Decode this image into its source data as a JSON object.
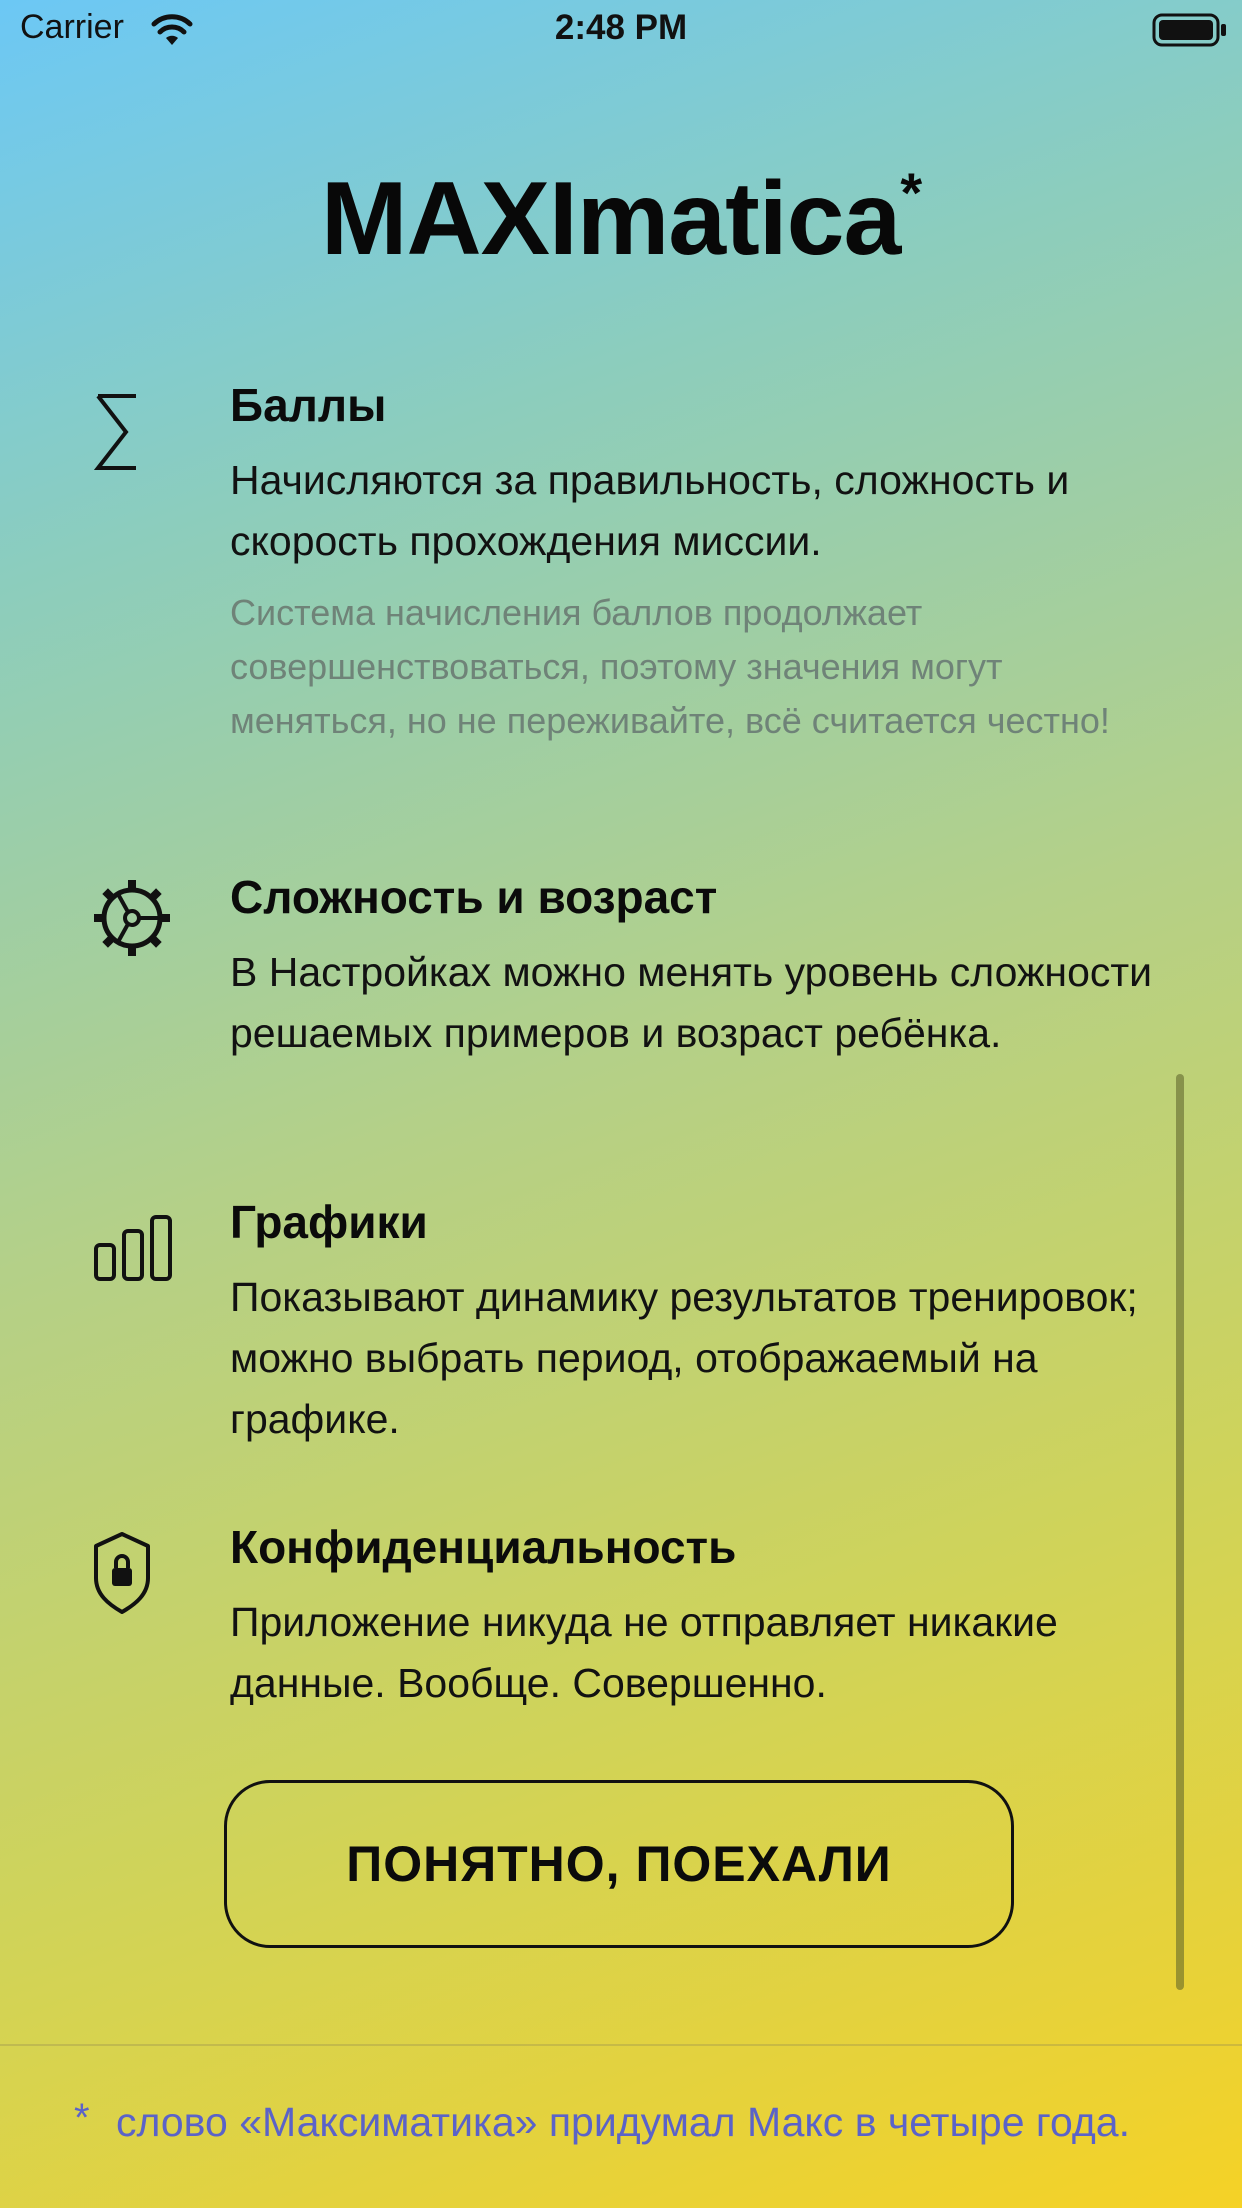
{
  "status_bar": {
    "carrier": "Carrier",
    "time": "2:48 PM",
    "wifi_icon": "wifi-icon",
    "battery_icon": "battery-icon"
  },
  "header": {
    "title": "MAXImatica",
    "asterisk": "*"
  },
  "features": [
    {
      "icon": "sigma-icon",
      "heading": "Баллы",
      "body": "Начисляются за правильность, сложность и скорость прохождения миссии.",
      "note": "Система начисления баллов продолжает совершенствоваться, поэтому значения могут меняться, но не переживайте, всё считается честно!"
    },
    {
      "icon": "gear-icon",
      "heading": "Сложность и возраст",
      "body": "В Настройках можно менять уровень сложности решаемых примеров и возраст ребёнка."
    },
    {
      "icon": "bar-chart-icon",
      "heading": "Графики",
      "body": "Показывают динамику результатов тренировок; можно выбрать период, отображаемый на графике."
    },
    {
      "icon": "lock-shield-icon",
      "heading": "Конфиденциальность",
      "body": "Приложение никуда не отправляет никакие данные. Вообще. Совершенно."
    }
  ],
  "cta_button": {
    "label": "ПОНЯТНО, ПОЕХАЛИ"
  },
  "footnote": {
    "star": "*",
    "text": "слово «Максиматика» придумал Макс в четыре года."
  },
  "colors": {
    "gradient_top": "#6cc8f5",
    "gradient_bottom": "#f5d226",
    "footnote_text": "#5b63c8",
    "note_text": "#6f8378"
  }
}
